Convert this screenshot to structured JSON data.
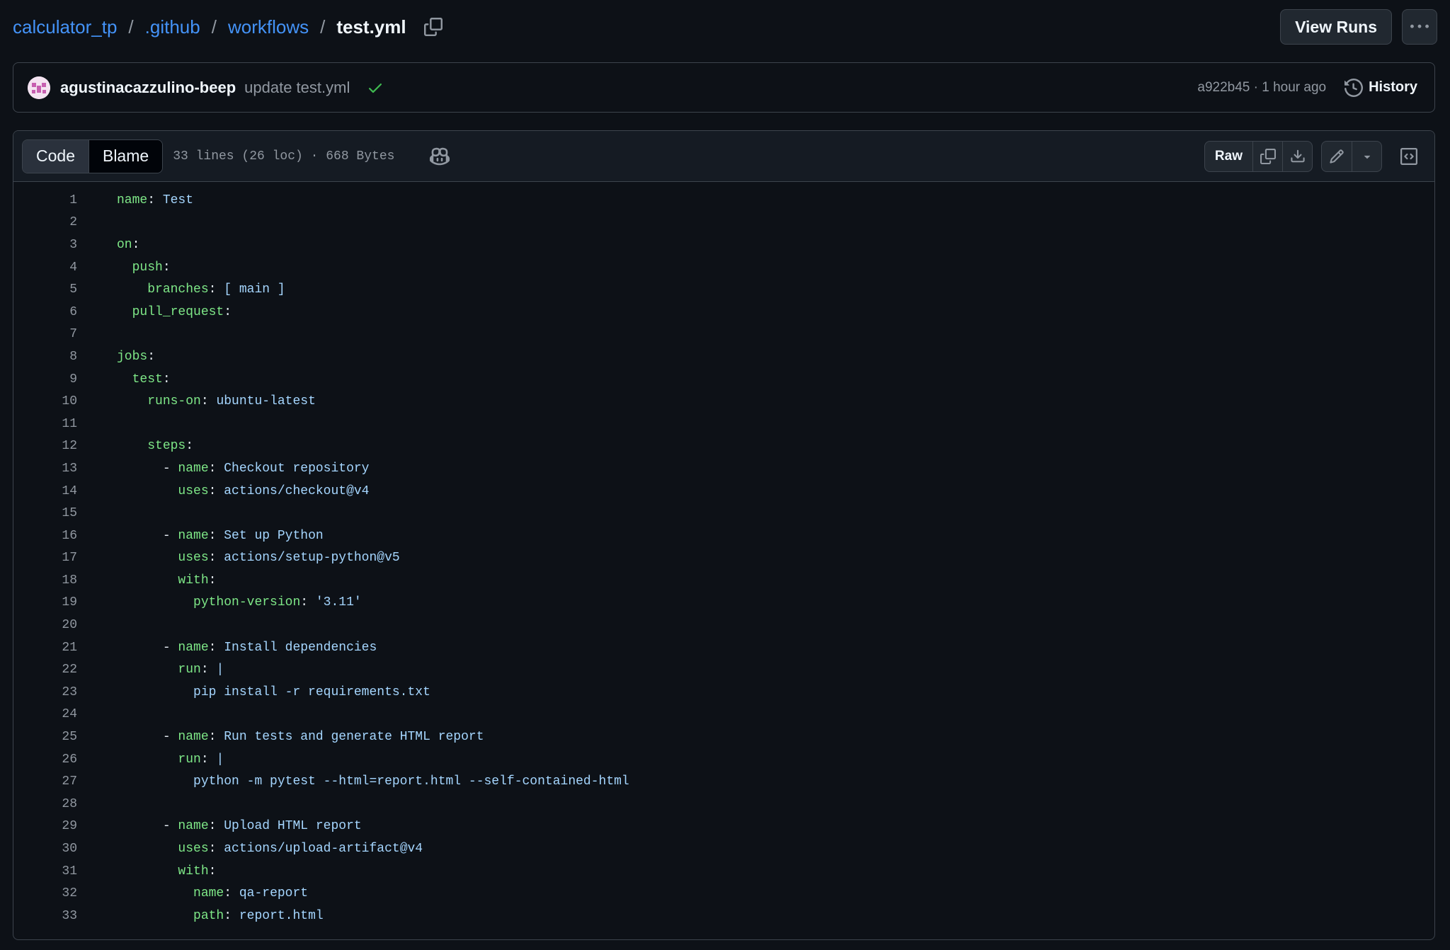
{
  "breadcrumb": {
    "repo": "calculator_tp",
    "dir1": ".github",
    "dir2": "workflows",
    "file": "test.yml",
    "separator": "/"
  },
  "actions": {
    "view_runs": "View Runs"
  },
  "commit": {
    "author": "agustinacazzulino-beep",
    "message": "update test.yml",
    "meta": "a922b45 · 1 hour ago",
    "history_label": "History"
  },
  "file": {
    "tab_code": "Code",
    "tab_blame": "Blame",
    "info": "33 lines (26 loc) · 668 Bytes",
    "raw_label": "Raw"
  },
  "code_lines": [
    {
      "indent": "",
      "dash": "",
      "key": "name",
      "value": "Test"
    },
    {
      "indent": "",
      "dash": "",
      "key": "",
      "value": ""
    },
    {
      "indent": "",
      "dash": "",
      "key": "on",
      "value": ""
    },
    {
      "indent": "  ",
      "dash": "",
      "key": "push",
      "value": ""
    },
    {
      "indent": "    ",
      "dash": "",
      "key": "branches",
      "value": "[ main ]"
    },
    {
      "indent": "  ",
      "dash": "",
      "key": "pull_request",
      "value": ""
    },
    {
      "indent": "",
      "dash": "",
      "key": "",
      "value": ""
    },
    {
      "indent": "",
      "dash": "",
      "key": "jobs",
      "value": ""
    },
    {
      "indent": "  ",
      "dash": "",
      "key": "test",
      "value": ""
    },
    {
      "indent": "    ",
      "dash": "",
      "key": "runs-on",
      "value": "ubuntu-latest"
    },
    {
      "indent": "",
      "dash": "",
      "key": "",
      "value": ""
    },
    {
      "indent": "    ",
      "dash": "",
      "key": "steps",
      "value": ""
    },
    {
      "indent": "      ",
      "dash": "- ",
      "key": "name",
      "value": "Checkout repository"
    },
    {
      "indent": "        ",
      "dash": "",
      "key": "uses",
      "value": "actions/checkout@v4"
    },
    {
      "indent": "",
      "dash": "",
      "key": "",
      "value": ""
    },
    {
      "indent": "      ",
      "dash": "- ",
      "key": "name",
      "value": "Set up Python"
    },
    {
      "indent": "        ",
      "dash": "",
      "key": "uses",
      "value": "actions/setup-python@v5"
    },
    {
      "indent": "        ",
      "dash": "",
      "key": "with",
      "value": ""
    },
    {
      "indent": "          ",
      "dash": "",
      "key": "python-version",
      "value": "'3.11'"
    },
    {
      "indent": "",
      "dash": "",
      "key": "",
      "value": ""
    },
    {
      "indent": "      ",
      "dash": "- ",
      "key": "name",
      "value": "Install dependencies"
    },
    {
      "indent": "        ",
      "dash": "",
      "key": "run",
      "value": "|"
    },
    {
      "indent": "          ",
      "dash": "",
      "key": "",
      "value": "pip install -r requirements.txt"
    },
    {
      "indent": "",
      "dash": "",
      "key": "",
      "value": ""
    },
    {
      "indent": "      ",
      "dash": "- ",
      "key": "name",
      "value": "Run tests and generate HTML report"
    },
    {
      "indent": "        ",
      "dash": "",
      "key": "run",
      "value": "|"
    },
    {
      "indent": "          ",
      "dash": "",
      "key": "",
      "value": "python -m pytest --html=report.html --self-contained-html"
    },
    {
      "indent": "",
      "dash": "",
      "key": "",
      "value": ""
    },
    {
      "indent": "      ",
      "dash": "- ",
      "key": "name",
      "value": "Upload HTML report"
    },
    {
      "indent": "        ",
      "dash": "",
      "key": "uses",
      "value": "actions/upload-artifact@v4"
    },
    {
      "indent": "        ",
      "dash": "",
      "key": "with",
      "value": ""
    },
    {
      "indent": "          ",
      "dash": "",
      "key": "name",
      "value": "qa-report"
    },
    {
      "indent": "          ",
      "dash": "",
      "key": "path",
      "value": "report.html"
    }
  ],
  "colors": {
    "background": "#0d1117",
    "link": "#4493f8",
    "yaml_key": "#7ee787",
    "yaml_value": "#a5d6ff",
    "success": "#3fb950"
  },
  "icons": [
    "copy-icon",
    "kebab-icon",
    "avatar",
    "check-icon",
    "history-icon",
    "copilot-icon",
    "copy-raw-icon",
    "download-icon",
    "pencil-icon",
    "triangle-down-icon",
    "code-square-icon"
  ]
}
